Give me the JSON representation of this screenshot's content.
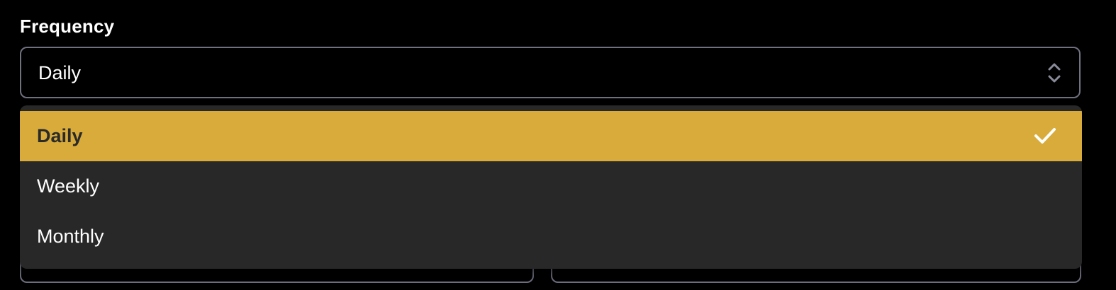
{
  "frequency": {
    "label": "Frequency",
    "selected_value": "Daily",
    "options": [
      {
        "label": "Daily",
        "selected": true
      },
      {
        "label": "Weekly",
        "selected": false
      },
      {
        "label": "Monthly",
        "selected": false
      }
    ]
  },
  "colors": {
    "background": "#000000",
    "field_border": "#6f7080",
    "dropdown_bg": "#282828",
    "selected_bg": "#d8ab3a",
    "selected_text": "#2a2a2a",
    "text": "#ffffff"
  },
  "icons": {
    "select_indicator": "chevron-up-down-icon",
    "selected_marker": "check-icon"
  }
}
